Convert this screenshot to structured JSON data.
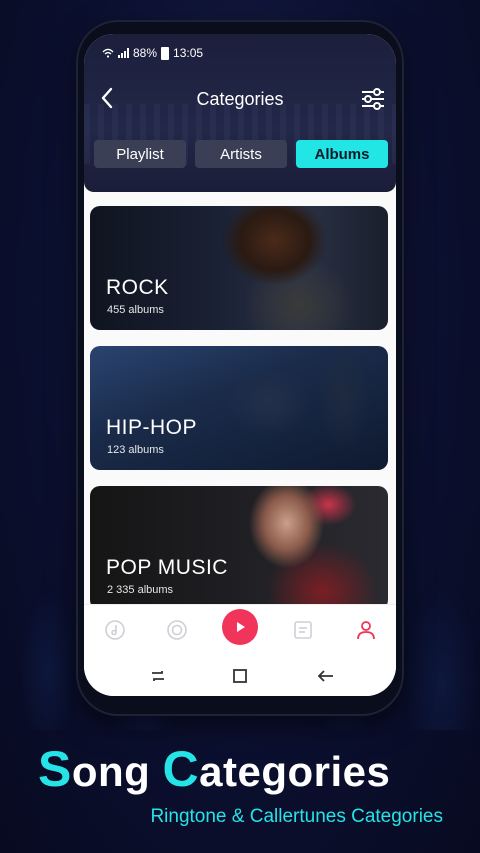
{
  "status_bar": {
    "battery": "88%",
    "time": "13:05"
  },
  "header": {
    "title": "Categories"
  },
  "tabs": [
    {
      "label": "Playlist",
      "active": false
    },
    {
      "label": "Artists",
      "active": false
    },
    {
      "label": "Albums",
      "active": true
    }
  ],
  "categories": [
    {
      "name": "ROCK",
      "count": "455 albums"
    },
    {
      "name": "HIP-HOP",
      "count": "123 albums"
    },
    {
      "name": "POP MUSIC",
      "count": "2 335 albums"
    }
  ],
  "bottom_nav": {
    "items": [
      "music-disc-icon",
      "vinyl-icon",
      "play-icon",
      "notes-icon",
      "profile-icon"
    ],
    "accent_color": "#f0345a"
  },
  "promo": {
    "headline_cap1": "S",
    "headline_rest1": "ong ",
    "headline_cap2": "C",
    "headline_rest2": "ategories",
    "subline": "Ringtone & Callertunes Categories",
    "accent_color": "#25e3e6"
  }
}
